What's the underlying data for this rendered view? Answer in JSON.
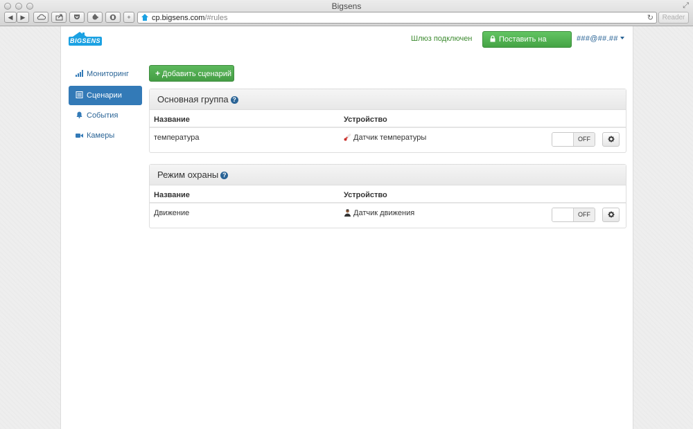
{
  "window": {
    "title": "Bigsens",
    "url_host": "cp.bigsens.com",
    "url_path": "/#rules",
    "reader_label": "Reader"
  },
  "header": {
    "logo_text": "BIGSENS",
    "gateway_status": "Шлюз подключен",
    "arm_button": "Поставить на охрану",
    "user": "###@##.##"
  },
  "sidebar": {
    "items": [
      {
        "label": "Мониторинг",
        "icon": "bar-chart-icon",
        "active": false
      },
      {
        "label": "Сценарии",
        "icon": "list-icon",
        "active": true
      },
      {
        "label": "События",
        "icon": "bell-icon",
        "active": false
      },
      {
        "label": "Камеры",
        "icon": "video-camera-icon",
        "active": false
      }
    ]
  },
  "main": {
    "add_button": "Добавить сценарий",
    "groups": [
      {
        "title": "Основная группа",
        "col_name": "Название",
        "col_device": "Устройство",
        "rows": [
          {
            "name": "температура",
            "device": "Датчик температуры",
            "device_icon": "thermometer-icon",
            "toggle": "OFF"
          }
        ]
      },
      {
        "title": "Режим охраны",
        "col_name": "Название",
        "col_device": "Устройство",
        "rows": [
          {
            "name": "Движение",
            "device": "Датчик движения",
            "device_icon": "person-icon",
            "toggle": "OFF"
          }
        ]
      }
    ]
  },
  "colors": {
    "accent": "#337ab7",
    "link": "#2a6496",
    "success": "#5cb85c",
    "gateway_ok": "#3c8a2f",
    "logo": "#1ba1e2"
  }
}
